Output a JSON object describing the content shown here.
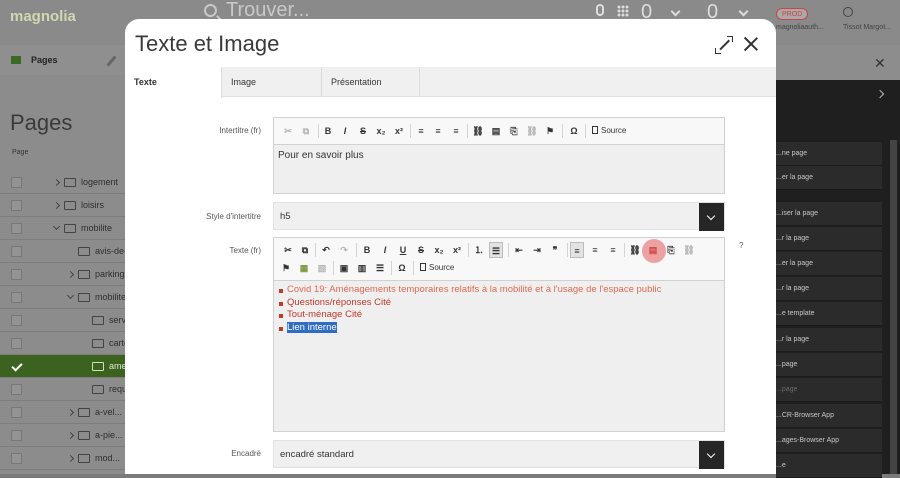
{
  "app": {
    "logo": "magnolia",
    "search_placeholder": "Trouver...",
    "notifications_count": "0",
    "tasks_count": "0",
    "env_badge": "PROD",
    "instance_label": "magnoliaauth...",
    "user_label": "Tissot Margot..."
  },
  "left": {
    "app_tab": "Pages",
    "title": "Pages",
    "column_header": "Page",
    "rows": [
      {
        "label": "logement",
        "expand": "collapsed",
        "selected": false
      },
      {
        "label": "loisirs",
        "expand": "collapsed",
        "selected": false
      },
      {
        "label": "mobilite",
        "expand": "expanded",
        "selected": false
      },
      {
        "label": "avis-de-...",
        "expand": "none",
        "selected": false
      },
      {
        "label": "parkings",
        "expand": "collapsed",
        "selected": false
      },
      {
        "label": "mobilite...",
        "expand": "expanded",
        "selected": false
      },
      {
        "label": "servi...",
        "expand": "none",
        "selected": false
      },
      {
        "label": "carte...",
        "expand": "none",
        "selected": false
      },
      {
        "label": "ame...",
        "expand": "none",
        "selected": true
      },
      {
        "label": "requ...",
        "expand": "none",
        "selected": false
      },
      {
        "label": "a-vel...",
        "expand": "collapsed",
        "selected": false
      },
      {
        "label": "a-pie...",
        "expand": "collapsed",
        "selected": false
      },
      {
        "label": "mod...",
        "expand": "collapsed",
        "selected": false
      }
    ]
  },
  "actions": [
    {
      "label": "...ne page",
      "enabled": true
    },
    {
      "label": "...er la page",
      "enabled": true
    },
    {
      "label": "...iser la page",
      "enabled": true
    },
    {
      "label": "...r la page",
      "enabled": true
    },
    {
      "label": "...er la page",
      "enabled": true
    },
    {
      "label": "...r la page",
      "enabled": true
    },
    {
      "label": "...e template",
      "enabled": true
    },
    {
      "label": "...r la page",
      "enabled": true
    },
    {
      "label": "...page",
      "enabled": true
    },
    {
      "label": "...page",
      "enabled": false
    },
    {
      "label": "...CR-Browser App",
      "enabled": true
    },
    {
      "label": "...ages-Browser App",
      "enabled": true
    },
    {
      "label": "...e",
      "enabled": true
    }
  ],
  "dialog": {
    "title": "Texte et Image",
    "tabs": [
      "Texte",
      "Image",
      "Présentation"
    ],
    "active_tab": "Texte",
    "fields": {
      "intertitre": {
        "label": "Intertitre (fr)",
        "value": "Pour en savoir plus"
      },
      "style": {
        "label": "Style d'intertitre",
        "value": "h5"
      },
      "texte": {
        "label": "Texte (fr)",
        "help": "?",
        "list": [
          {
            "text": "Covid 19: Aménagements temporaires relatifs à la mobilité et à l'usage de l'espace public",
            "style": "link"
          },
          {
            "text": "Questions/réponses Cité",
            "style": "red"
          },
          {
            "text": "Tout-ménage Cité",
            "style": "red"
          },
          {
            "text": "Lien interne",
            "style": "selected"
          }
        ]
      },
      "encadre": {
        "label": "Encadré",
        "value": "encadré standard"
      }
    },
    "source_label": "Source"
  },
  "colors": {
    "accent_green": "#3b621f",
    "list_bullet": "#c0392b",
    "selection": "#2f6cc4",
    "click_marker": "#e65a5a"
  }
}
